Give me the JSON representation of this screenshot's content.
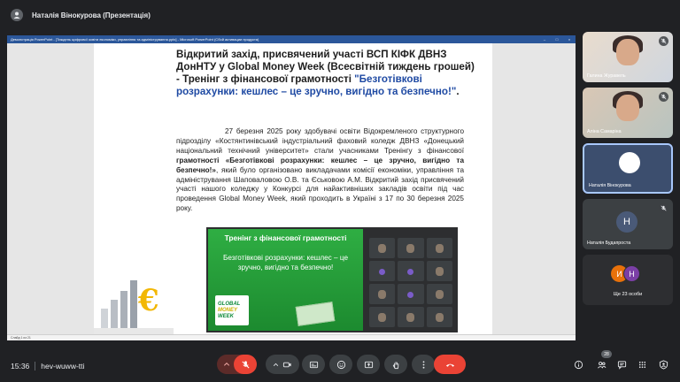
{
  "header": {
    "presenter_title": "Наталія Вінокурова (Презентація)"
  },
  "powerpoint": {
    "window_title": "Демонстрація PowerPoint - [Тиждень цифрової освіти економіки, управління та адміністрування.pptx] - Microsoft PowerPoint (Сбой активации продукта)",
    "status": "Слайд 1 из 21"
  },
  "slide": {
    "title": "Відкритий захід, присвячений участі ВСП КІФК ДВНЗ ДонНТУ у Global Money Week (Всесвітній тиждень грошей) - Тренінг з фінансової грамотності",
    "title_quote": "\"Безготівкові розрахунки: кешлес – це зручно, вигідно та безпечно!\"",
    "title_end": ".",
    "body_1": "27 березня 2025 року здобувачі освіти Відокремленого структурного підрозділу «Костянтинівський індустріальний фаховий коледж ДВНЗ «Донецький національний технічний університет» стали учасниками Тренінгу з фінансової ",
    "body_bold": "грамотності «Безготівкові розрахунки: кешлес – це зручно, вигідно та безпечно!»",
    "body_2": ", який було організовано викладачами комісії економіки, управління та адміністрування Шаповаловою О.В. та Єськовою А.М. Відкритий захід присвячений участі нашого коледжу у Конкурсі для найактивніших закладів освіти під час проведення Global Money Week, який проходить в Україні з 17 по 30 березня 2025 року.",
    "banner_title": "Тренінг з фінансової грамотності",
    "banner_sub": "Безготівкові розрахунки: кешлес – це зручно, вигідно та безпечно!",
    "logo_lines": [
      "GLOBAL",
      "MONEY",
      "WEEK"
    ]
  },
  "participants": [
    {
      "name": "Галина Журавель",
      "muted": true
    },
    {
      "name": "Аліна Самаріна",
      "muted": true
    },
    {
      "name": "Наталія Вінокурова",
      "muted": false
    },
    {
      "name": "Наталія Будапроста",
      "initial": "Н",
      "muted": true
    }
  ],
  "others": {
    "initials": [
      "И",
      "Н"
    ],
    "label": "Ще 23 особи"
  },
  "meeting": {
    "time": "15:36",
    "code": "hev-wuww-tti",
    "people_count": "28"
  },
  "colors": {
    "background": "#202124",
    "end_call": "#ea4335",
    "accent": "#a8c7fa",
    "ppt_blue": "#2b579a"
  }
}
